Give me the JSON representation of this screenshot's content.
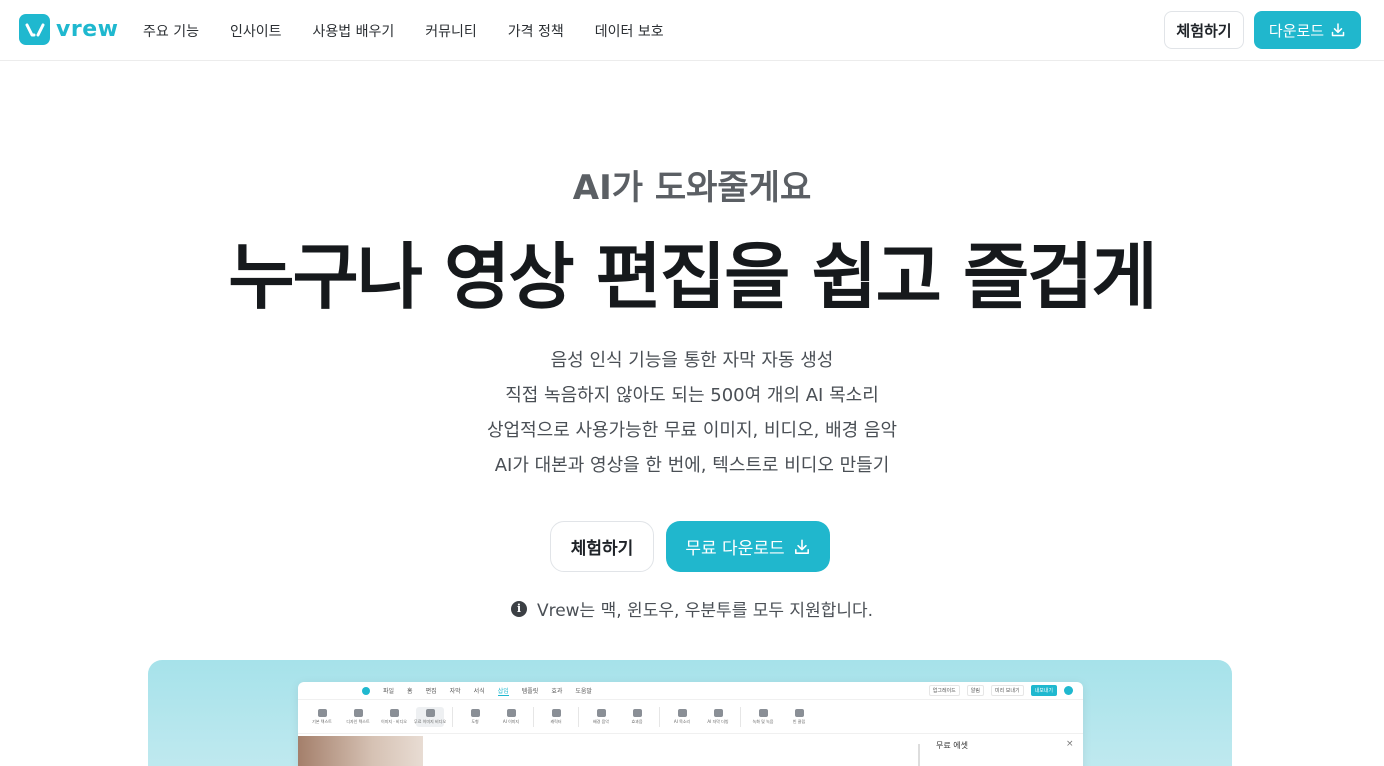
{
  "header": {
    "brand": "vrew",
    "nav": [
      "주요 기능",
      "인사이트",
      "사용법 배우기",
      "커뮤니티",
      "가격 정책",
      "데이터 보호"
    ],
    "try_label": "체험하기",
    "download_label": "다운로드"
  },
  "hero": {
    "eyebrow": "AI가 도와줄게요",
    "headline": "누구나 영상 편집을 쉽고 즐겁게",
    "features": [
      "음성 인식 기능을 통한 자막 자동 생성",
      "직접 녹음하지 않아도 되는 500여 개의 AI 목소리",
      "상업적으로 사용가능한 무료 이미지, 비디오, 배경 음악",
      "AI가 대본과 영상을 한 번에, 텍스트로 비디오 만들기"
    ],
    "cta_try": "체험하기",
    "cta_download": "무료 다운로드",
    "support_note": "Vrew는 맥, 윈도우, 우분투를 모두 지원합니다."
  },
  "preview": {
    "menu": [
      "파일",
      "홈",
      "편집",
      "자막",
      "서식",
      "삽입",
      "템플릿",
      "효과",
      "도움말"
    ],
    "active_menu": "삽입",
    "right_buttons": [
      "업그레이드",
      "알림",
      "미리 보내기",
      "내보내기"
    ],
    "tools": [
      "기본 텍스트",
      "디자인 텍스트",
      "이미지 · 비디오",
      "무료 이미지 비디오",
      "도형",
      "AI 이미지",
      "캐릭터",
      "배경 음악",
      "효과음",
      "AI 목소리",
      "AI 자막 더빙",
      "녹화 및 녹음",
      "빈 클립"
    ],
    "panel_title": "무료 에셋",
    "panel_close": "×"
  },
  "colors": {
    "accent": "#20b7cd",
    "preview_bg": "#a6e2ea"
  }
}
